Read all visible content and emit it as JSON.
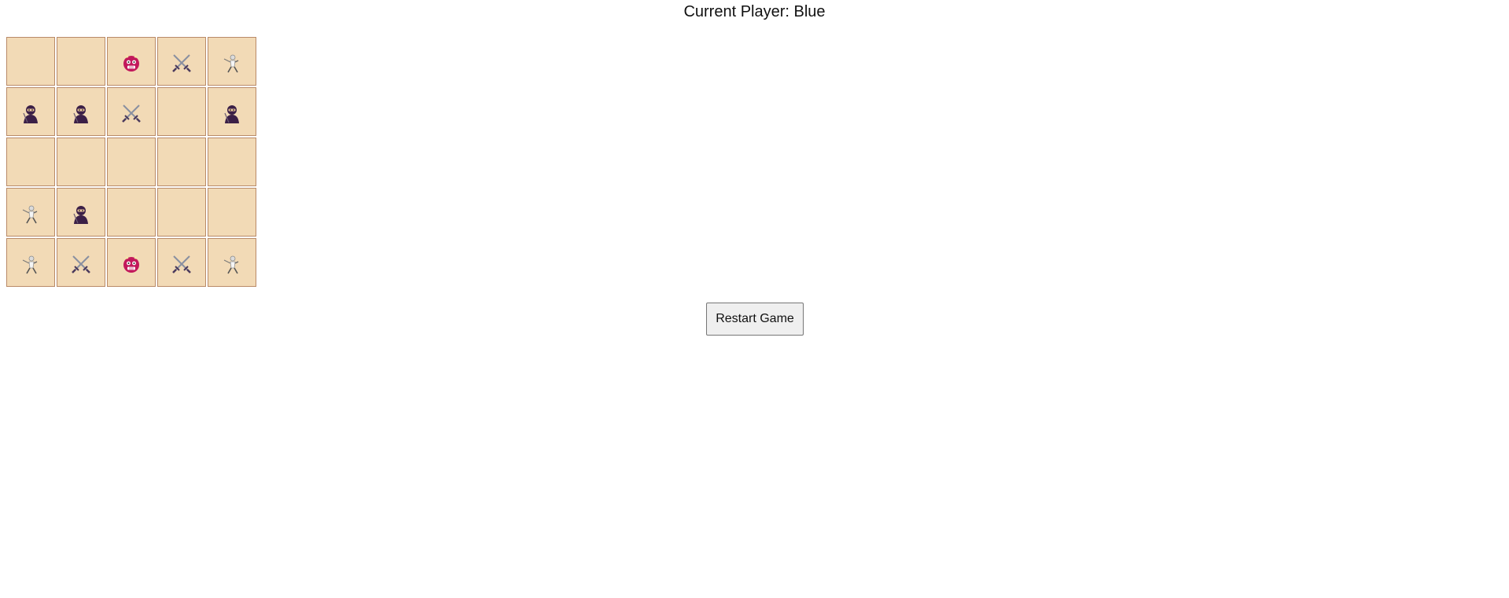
{
  "status": {
    "label": "Current Player: Blue"
  },
  "board": {
    "rows": [
      [
        "empty",
        "empty",
        "oni-icon",
        "crossed-swords-icon",
        "fencer-icon"
      ],
      [
        "ninja-icon",
        "ninja-icon",
        "crossed-swords-icon",
        "empty",
        "ninja-icon"
      ],
      [
        "empty",
        "empty",
        "empty",
        "empty",
        "empty"
      ],
      [
        "fencer-icon",
        "ninja-icon",
        "empty",
        "empty",
        "empty"
      ],
      [
        "fencer-icon",
        "crossed-swords-icon",
        "oni-icon",
        "crossed-swords-icon",
        "fencer-icon"
      ]
    ]
  },
  "controls": {
    "restart_label": "Restart Game"
  },
  "colors": {
    "cell_fill": "#f2dab6",
    "cell_border": "#b98a68",
    "ninja": "#3b1f47",
    "oni": "#c2185b",
    "blade": "#8a8fa0"
  }
}
